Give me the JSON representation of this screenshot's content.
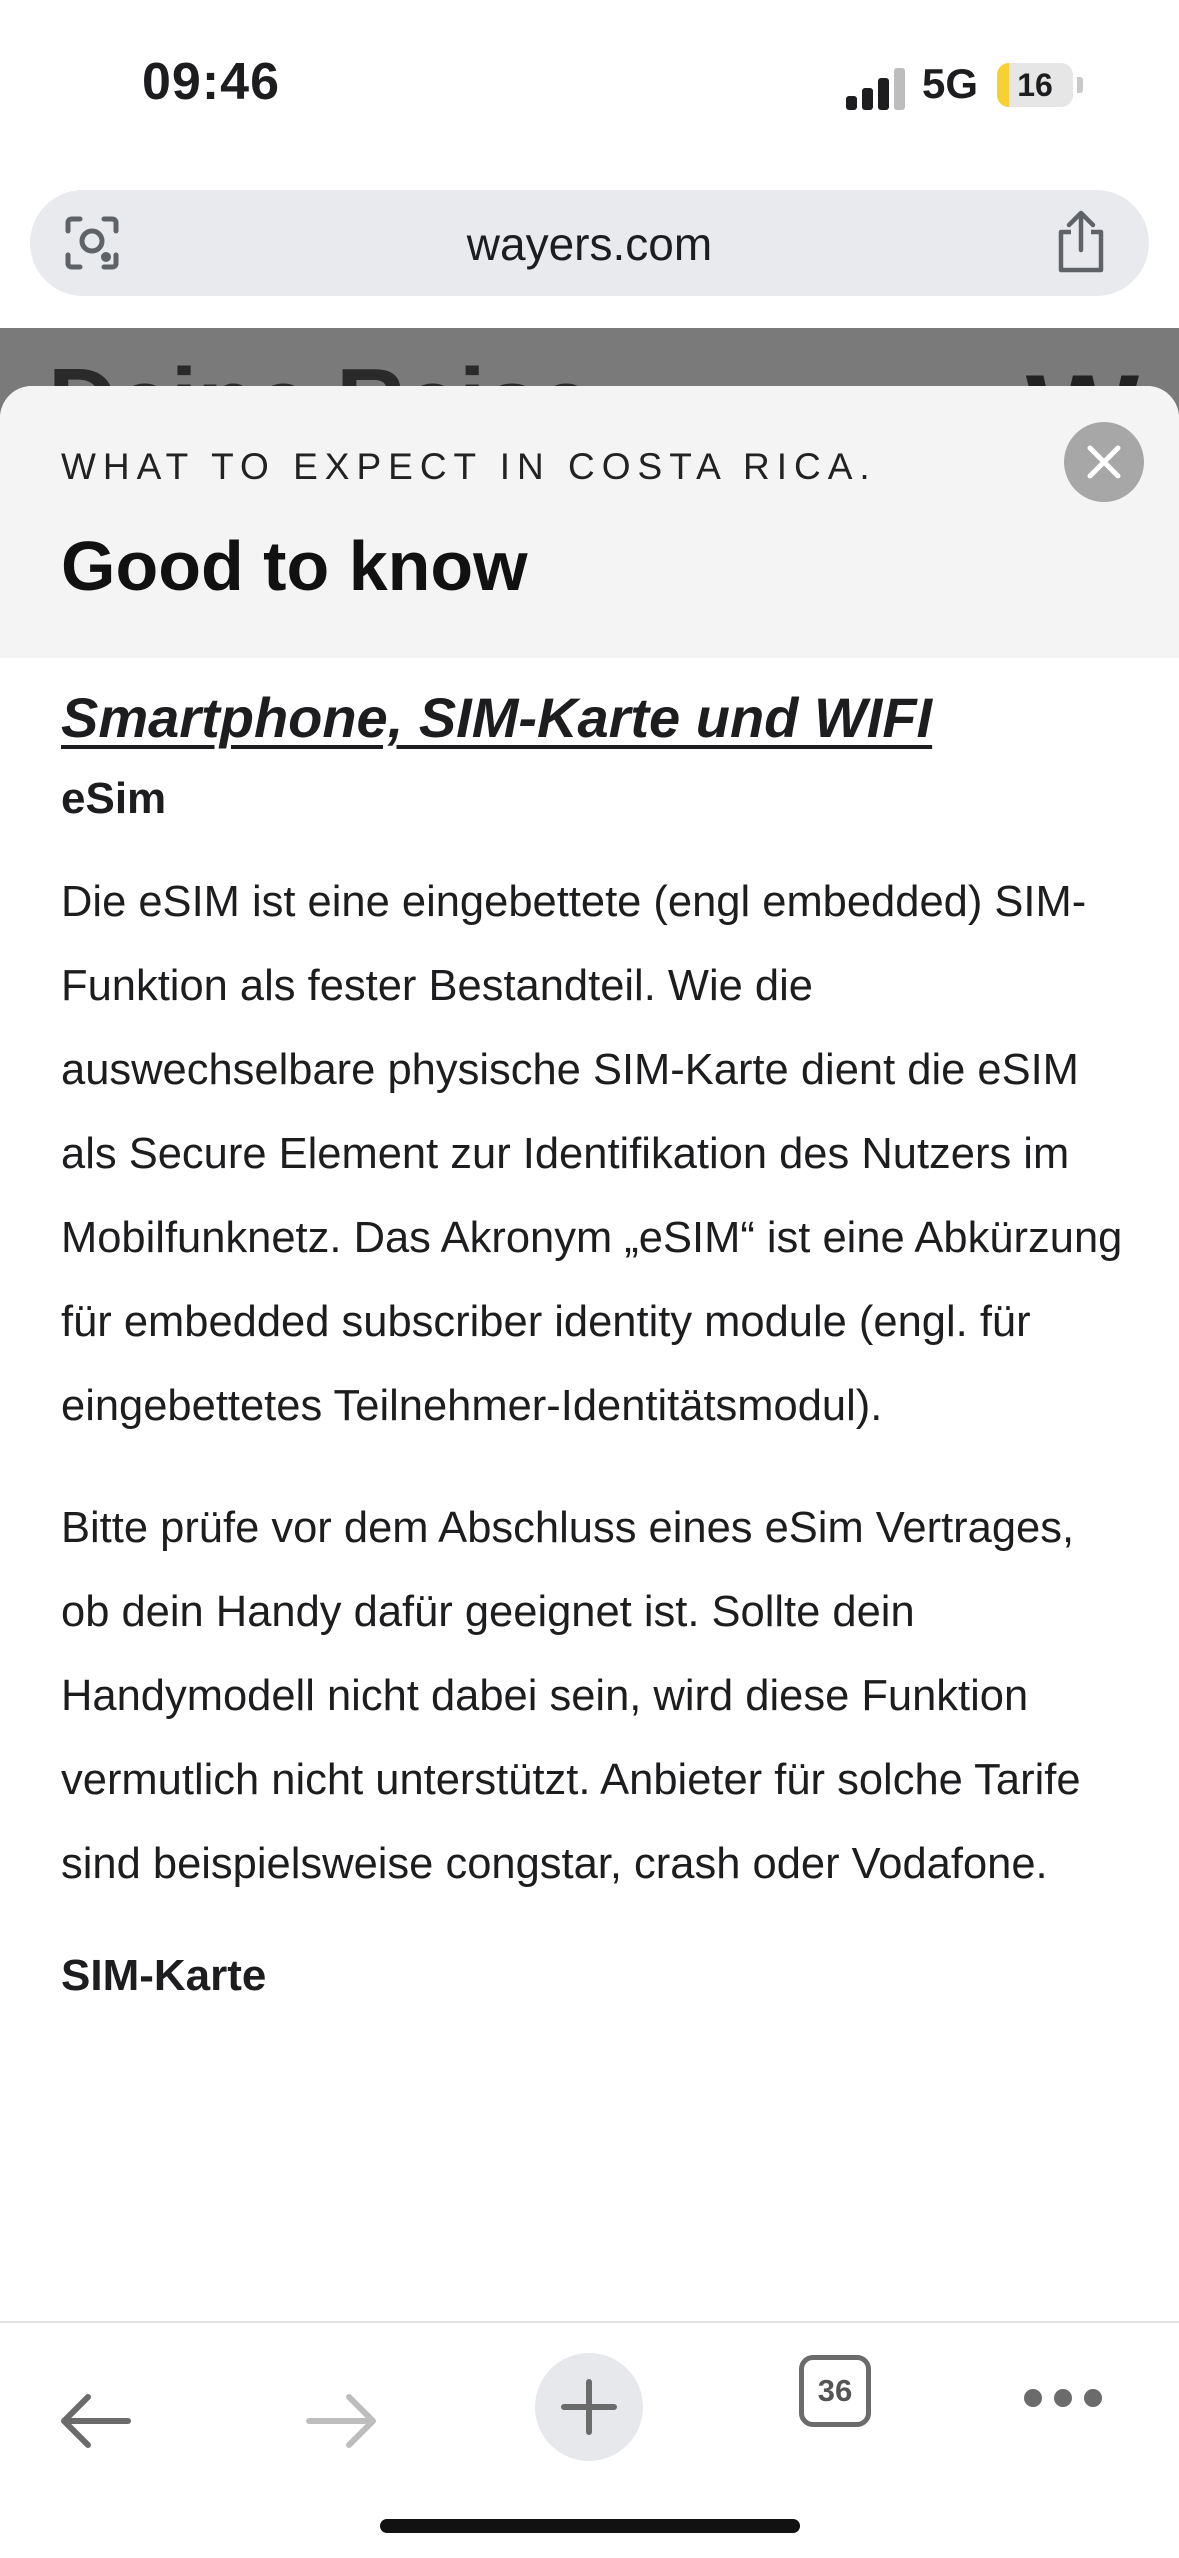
{
  "status_bar": {
    "time": "09:46",
    "network": "5G",
    "battery_level": "16",
    "battery_fraction": 0.16,
    "battery_color": "#f7d031"
  },
  "browser": {
    "url": "wayers.com",
    "left_icon": "lens-icon",
    "right_icon": "share-icon"
  },
  "background_page": {
    "title_partial": "Deine Reise",
    "logo": "W"
  },
  "sheet": {
    "eyebrow": "WHAT TO EXPECT IN COSTA RICA.",
    "title": "Good to know",
    "close_icon": "close-icon",
    "section_heading": "Smartphone, SIM-Karte und WIFI",
    "esim_heading": "eSim",
    "esim_paragraph_1": "Die eSIM ist eine eingebettete (engl embedded) SIM-Funktion als fester Bestandteil. Wie die auswechselbare physische SIM-Karte dient die eSIM als Secure Element zur Identifikation des Nutzers im Mobilfunknetz. Das Akronym „eSIM“ ist eine Abkürzung für embedded subscriber identity module (engl. für eingebettetes Teilnehmer-Identitätsmodul).",
    "esim_paragraph_2": "Bitte prüfe vor dem Abschluss eines eSim Vertrages, ob dein Handy dafür geeignet ist. Sollte dein Handymodell nicht dabei sein, wird diese Funktion vermutlich nicht unterstützt. Anbieter für solche Tarife sind beispielsweise congstar, crash oder Vodafone.",
    "sim_heading": "SIM-Karte"
  },
  "toolbar": {
    "back_icon": "back-arrow-icon",
    "forward_icon": "forward-arrow-icon",
    "new_tab_icon": "plus-icon",
    "tab_count": "36",
    "more_icon": "more-dots-icon"
  }
}
